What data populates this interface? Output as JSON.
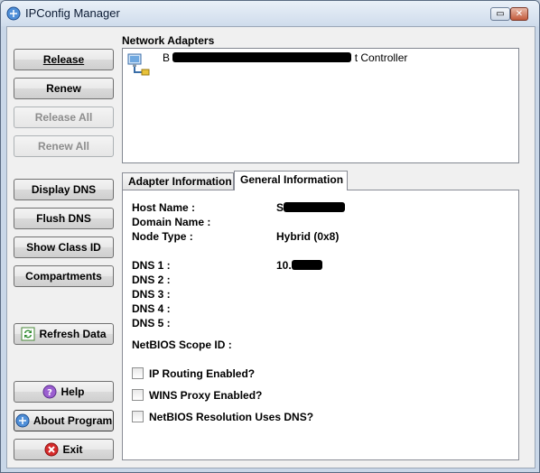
{
  "window": {
    "title": "IPConfig Manager",
    "minimize_glyph": "▭",
    "close_glyph": "✕"
  },
  "buttons": {
    "release": "Release",
    "renew": "Renew",
    "release_all": "Release All",
    "renew_all": "Renew All",
    "display_dns": "Display DNS",
    "flush_dns": "Flush DNS",
    "show_class_id": "Show Class ID",
    "compartments": "Compartments",
    "refresh_data": "Refresh Data",
    "help": "Help",
    "about_program": "About Program",
    "exit": "Exit"
  },
  "adapters": {
    "label": "Network Adapters",
    "items": [
      {
        "prefix": "B",
        "suffix": "t Controller",
        "icon": "network-adapter-icon"
      }
    ]
  },
  "tabs": [
    {
      "label": "Adapter Information",
      "active": false
    },
    {
      "label": "General Information",
      "active": true
    }
  ],
  "general": {
    "host_name_label": "Host Name :",
    "host_name_value": "S",
    "domain_name_label": "Domain Name :",
    "node_type_label": "Node Type :",
    "node_type_value": "Hybrid (0x8)",
    "dns1_label": "DNS 1 :",
    "dns1_value": "10.",
    "dns2_label": "DNS 2 :",
    "dns3_label": "DNS 3 :",
    "dns4_label": "DNS 4 :",
    "dns5_label": "DNS 5 :",
    "netbios_scope_label": "NetBIOS Scope ID :",
    "ip_routing_label": "IP Routing Enabled?",
    "wins_proxy_label": "WINS Proxy Enabled?",
    "netbios_dns_label": "NetBIOS Resolution Uses DNS?"
  },
  "colors": {
    "accent": "#1e64c8",
    "title_bar": "#dbe6f3",
    "disabled_text": "#8d8d8d"
  }
}
